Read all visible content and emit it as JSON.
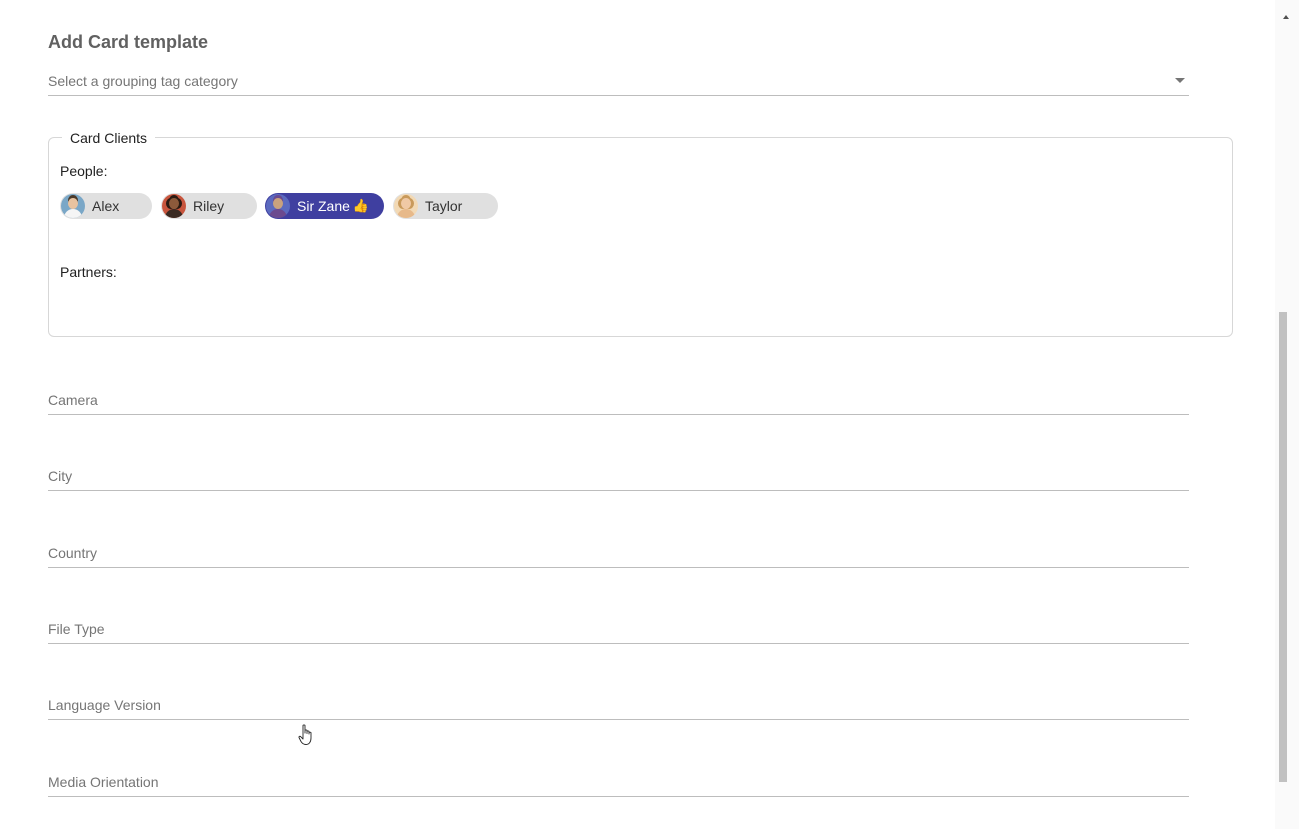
{
  "form": {
    "title": "Add Card template",
    "grouping_select": {
      "placeholder": "Select a grouping tag category"
    }
  },
  "card_clients": {
    "legend": "Card Clients",
    "people_label": "People:",
    "partners_label": "Partners:",
    "people": [
      {
        "name": "Alex",
        "selected": false,
        "avatar_bg": "#7aa7c7",
        "skin": "#e8c3a0",
        "hair": "#4a3a2a"
      },
      {
        "name": "Riley",
        "selected": false,
        "avatar_bg": "#c8553d",
        "skin": "#8d5a3b",
        "hair": "#2b1a12"
      },
      {
        "name": "Sir Zane",
        "selected": true,
        "avatar_bg": "#5b6abf",
        "skin": "#c9a27e",
        "hair": "#6b4a8f",
        "badge": "thumbs-up-icon"
      },
      {
        "name": "Taylor",
        "selected": false,
        "avatar_bg": "#f2d9b5",
        "skin": "#f0c9a5",
        "hair": "#c99a5b"
      }
    ]
  },
  "fields": [
    {
      "label": "Camera"
    },
    {
      "label": "City"
    },
    {
      "label": "Country"
    },
    {
      "label": "File Type"
    },
    {
      "label": "Language Version"
    },
    {
      "label": "Media Orientation"
    }
  ],
  "colors": {
    "selected_chip": "#3f3fa0",
    "chip": "#e0e0e0"
  }
}
